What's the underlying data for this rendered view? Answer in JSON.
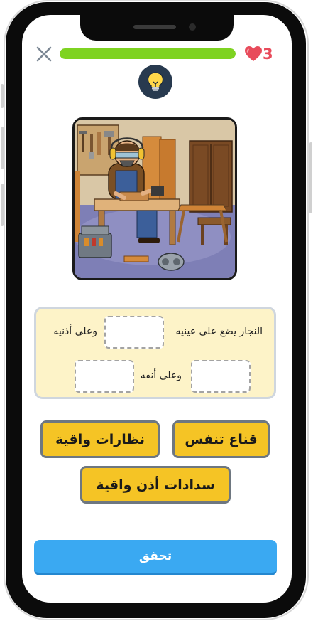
{
  "header": {
    "close_icon": "close-icon",
    "progress_fraction": 1.0,
    "progress_color": "#7ed321",
    "lives_count": "3",
    "lives_icon": "heart-icon",
    "lives_color": "#e84b5b"
  },
  "hint": {
    "icon": "lightbulb-icon",
    "bg_color": "#283a4f",
    "bulb_color": "#ffd84a"
  },
  "illustration": {
    "subject": "carpenter-workshop-illustration"
  },
  "sentence": {
    "part1": "النجار يضع على عينيه",
    "part2": "وعلى أذنيه",
    "part3": "وعلى أنفه"
  },
  "options": [
    {
      "label": "قناع تنفس"
    },
    {
      "label": "نظارات واقية"
    },
    {
      "label": "سدادات أذن واقية"
    }
  ],
  "check_button": {
    "label": "تحقق",
    "color": "#3aa9f2"
  },
  "colors": {
    "option_bg": "#f5c425",
    "sentence_bg": "#fdf3c8"
  }
}
